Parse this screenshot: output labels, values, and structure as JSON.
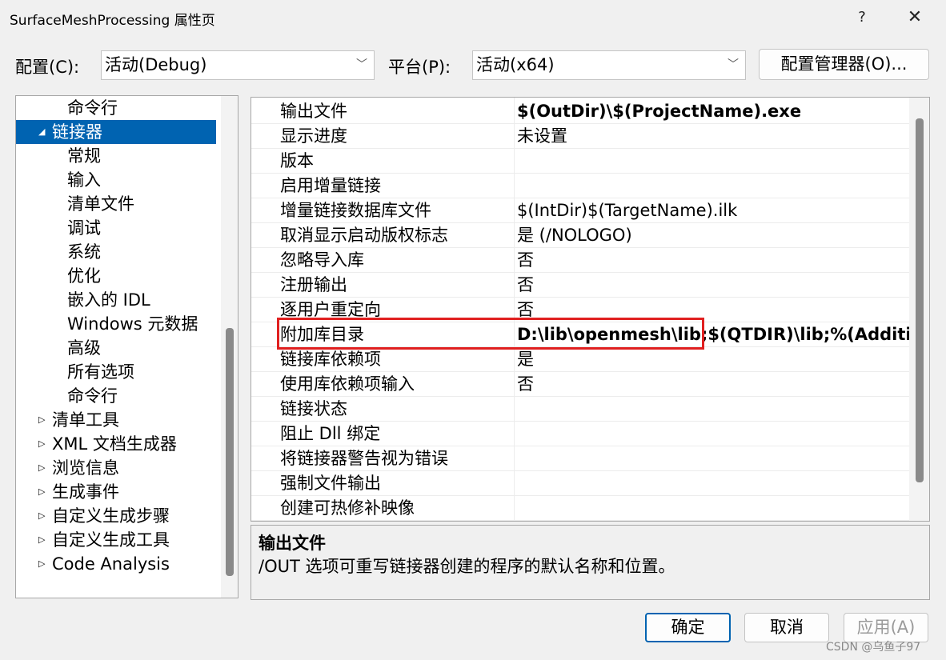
{
  "window": {
    "title": "SurfaceMeshProcessing 属性页",
    "help_label": "?",
    "close_label": "✕"
  },
  "toolbar": {
    "config_label": "配置(C):",
    "config_value": "活动(Debug)",
    "platform_label": "平台(P):",
    "platform_value": "活动(x64)",
    "config_manager_label": "配置管理器(O)..."
  },
  "tree": {
    "items": [
      {
        "label": "命令行",
        "level": 2,
        "expander": ""
      },
      {
        "label": "链接器",
        "level": 1,
        "expander": "◢",
        "selected": true
      },
      {
        "label": "常规",
        "level": 2,
        "expander": ""
      },
      {
        "label": "输入",
        "level": 2,
        "expander": ""
      },
      {
        "label": "清单文件",
        "level": 2,
        "expander": ""
      },
      {
        "label": "调试",
        "level": 2,
        "expander": ""
      },
      {
        "label": "系统",
        "level": 2,
        "expander": ""
      },
      {
        "label": "优化",
        "level": 2,
        "expander": ""
      },
      {
        "label": "嵌入的 IDL",
        "level": 2,
        "expander": ""
      },
      {
        "label": "Windows 元数据",
        "level": 2,
        "expander": ""
      },
      {
        "label": "高级",
        "level": 2,
        "expander": ""
      },
      {
        "label": "所有选项",
        "level": 2,
        "expander": ""
      },
      {
        "label": "命令行",
        "level": 2,
        "expander": ""
      },
      {
        "label": "清单工具",
        "level": 1,
        "expander": "▷"
      },
      {
        "label": "XML 文档生成器",
        "level": 1,
        "expander": "▷"
      },
      {
        "label": "浏览信息",
        "level": 1,
        "expander": "▷"
      },
      {
        "label": "生成事件",
        "level": 1,
        "expander": "▷"
      },
      {
        "label": "自定义生成步骤",
        "level": 1,
        "expander": "▷"
      },
      {
        "label": "自定义生成工具",
        "level": 1,
        "expander": "▷"
      },
      {
        "label": "Code Analysis",
        "level": 1,
        "expander": "▷"
      }
    ]
  },
  "grid": {
    "rows": [
      {
        "name": "输出文件",
        "value": "$(OutDir)\\$(ProjectName).exe",
        "bold": true
      },
      {
        "name": "显示进度",
        "value": "未设置",
        "bold": false
      },
      {
        "name": "版本",
        "value": "",
        "bold": false
      },
      {
        "name": "启用增量链接",
        "value": "",
        "bold": false
      },
      {
        "name": "增量链接数据库文件",
        "value": "$(IntDir)$(TargetName).ilk",
        "bold": false
      },
      {
        "name": "取消显示启动版权标志",
        "value": "是 (/NOLOGO)",
        "bold": false
      },
      {
        "name": "忽略导入库",
        "value": "否",
        "bold": false
      },
      {
        "name": "注册输出",
        "value": "否",
        "bold": false
      },
      {
        "name": "逐用户重定向",
        "value": "否",
        "bold": false
      },
      {
        "name": "附加库目录",
        "value": "D:\\lib\\openmesh\\lib;$(QTDIR)\\lib;%(AdditionalLibraryDirectories)",
        "bold": true
      },
      {
        "name": "链接库依赖项",
        "value": "是",
        "bold": false
      },
      {
        "name": "使用库依赖项输入",
        "value": "否",
        "bold": false
      },
      {
        "name": "链接状态",
        "value": "",
        "bold": false
      },
      {
        "name": "阻止 Dll 绑定",
        "value": "",
        "bold": false
      },
      {
        "name": "将链接器警告视为错误",
        "value": "",
        "bold": false
      },
      {
        "name": "强制文件输出",
        "value": "",
        "bold": false
      },
      {
        "name": "创建可热修补映像",
        "value": "",
        "bold": false
      }
    ]
  },
  "description": {
    "title": "输出文件",
    "text": "/OUT 选项可重写链接器创建的程序的默认名称和位置。"
  },
  "buttons": {
    "ok": "确定",
    "cancel": "取消",
    "apply": "应用(A)"
  },
  "watermark": "CSDN @乌鱼子97",
  "colors": {
    "selection": "#0063b1",
    "highlight_box": "#e02020"
  }
}
